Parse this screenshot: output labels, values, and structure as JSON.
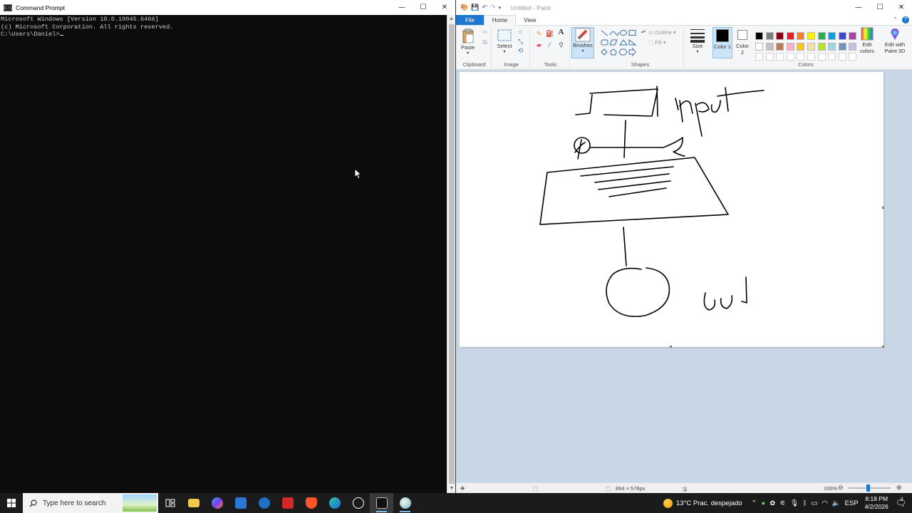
{
  "cmd": {
    "title": "Command Prompt",
    "lines": [
      "Microsoft Windows [Version 10.0.19045.6466]",
      "(c) Microsoft Corporation. All rights reserved.",
      "",
      "C:\\Users\\Daniel>"
    ]
  },
  "paint": {
    "title": "Untitled - Paint",
    "tabs": {
      "file": "File",
      "home": "Home",
      "view": "View"
    },
    "groups": {
      "clipboard": "Clipboard",
      "image": "Image",
      "tools": "Tools",
      "shapes": "Shapes",
      "colors": "Colors"
    },
    "buttons": {
      "paste": "Paste",
      "select": "Select",
      "brushes": "Brushes",
      "outline": "Outline",
      "fill": "Fill",
      "size": "Size",
      "color1": "Color 1",
      "color2": "Color 2",
      "edit_colors": "Edit colors",
      "edit_paint3d": "Edit with Paint 3D"
    },
    "palette_row1": [
      "#000000",
      "#7f7f7f",
      "#880015",
      "#ed1c24",
      "#ff7f27",
      "#fff200",
      "#22b14c",
      "#00a2e8",
      "#3f48cc",
      "#a349a4"
    ],
    "palette_row2": [
      "#ffffff",
      "#c3c3c3",
      "#b97a57",
      "#ffaec9",
      "#ffc90e",
      "#efe4b0",
      "#b5e61d",
      "#99d9ea",
      "#7092be",
      "#c8bfe7"
    ],
    "color1_value": "#000000",
    "color2_value": "#ffffff",
    "drawing_text": {
      "input": "input",
      "si": "si",
      "out": "out"
    },
    "status": {
      "canvas_size": "894 × 578px",
      "zoom": "100%"
    }
  },
  "taskbar": {
    "search_placeholder": "Type here to search",
    "weather": "13°C  Prac. despejado",
    "language": "ESP",
    "time": "8:18 PM",
    "date": "4/2/2026",
    "notification_count": "2"
  }
}
